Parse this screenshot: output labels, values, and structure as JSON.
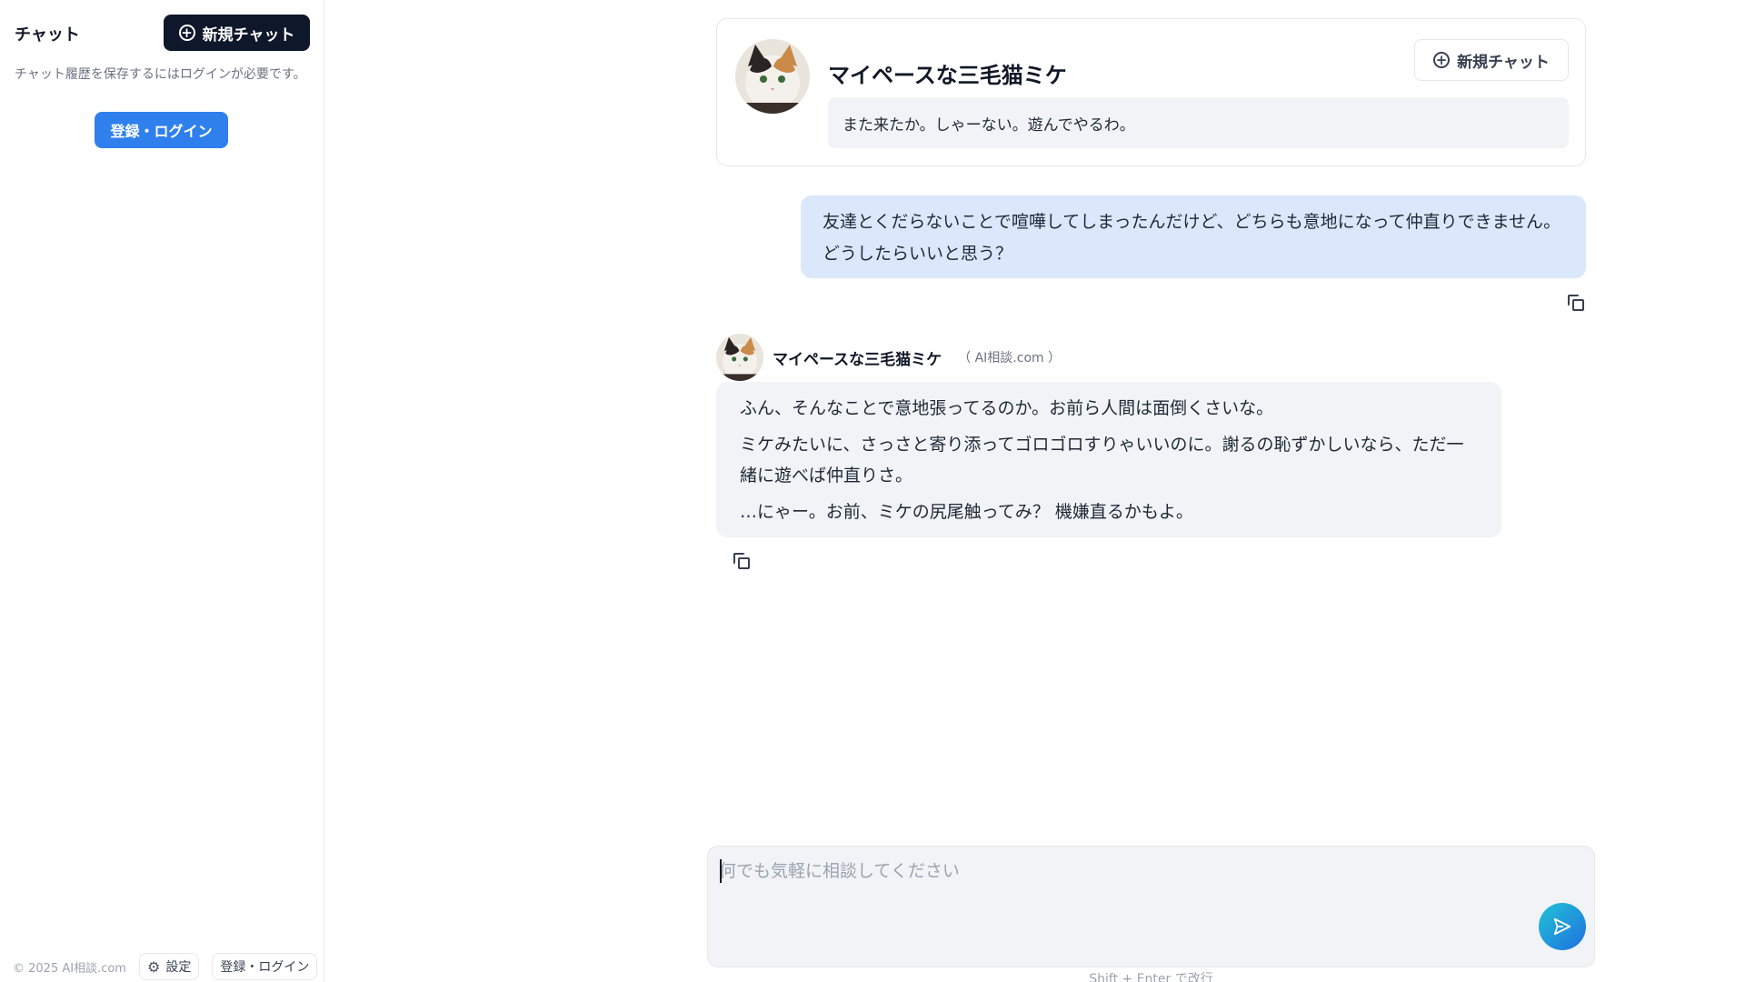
{
  "sidebar": {
    "title": "チャット",
    "new_chat_label": "新規チャット",
    "history_note": "チャット履歴を保存するにはログインが必要です。",
    "login_label": "登録・ログイン",
    "footer": {
      "copyright": "© 2025 AI相談.com",
      "settings_label": "設定",
      "login_label": "登録・ログイン"
    }
  },
  "character": {
    "name": "マイペースな三毛猫ミケ",
    "greeting": "また来たか。しゃーない。遊んでやるわ。",
    "new_chat_label": "新規チャット"
  },
  "messages": {
    "user": "友達とくだらないことで喧嘩してしまったんだけど、どちらも意地になって仲直りできません。どうしたらいいと思う？",
    "ai": {
      "name": "マイペースな三毛猫ミケ",
      "site": "（ AI相談.com ）",
      "paragraphs": [
        "ふん、そんなことで意地張ってるのか。お前ら人間は面倒くさいな。",
        "ミケみたいに、さっさと寄り添ってゴロゴロすりゃいいのに。謝るの恥ずかしいなら、ただ一緒に遊べば仲直りさ。",
        "…にゃー。お前、ミケの尻尾触ってみ？ 機嫌直るかもよ。"
      ]
    }
  },
  "composer": {
    "placeholder": "何でも気軽に相談してください",
    "hint": "Shift + Enter で改行"
  },
  "colors": {
    "primary_dark": "#0f172a",
    "login_blue": "#2f80ed",
    "user_bubble": "#dbe8fb",
    "ai_bubble": "#f1f3f6",
    "send_gradient": [
      "#22c3d6",
      "#1e6fe0"
    ]
  },
  "icons": {
    "new_chat": "plus-circle-icon",
    "settings": "gear-icon",
    "copy": "copy-icon",
    "send": "send-icon"
  }
}
